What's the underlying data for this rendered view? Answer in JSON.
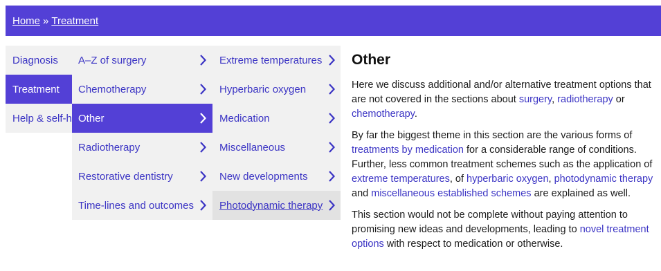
{
  "breadcrumb": {
    "home": "Home",
    "separator": "»",
    "current": "Treatment"
  },
  "nav_level1": [
    {
      "label": "Diagnosis",
      "active": false
    },
    {
      "label": "Treatment",
      "active": true
    },
    {
      "label": "Help & self-help",
      "active": false
    }
  ],
  "nav_level2": [
    {
      "label": "A–Z of surgery"
    },
    {
      "label": "Chemotherapy"
    },
    {
      "label": "Other"
    },
    {
      "label": "Radiotherapy"
    },
    {
      "label": "Restorative dentistry"
    },
    {
      "label": "Time-lines and outcomes"
    }
  ],
  "nav_level3": [
    {
      "label": "Extreme temperatures"
    },
    {
      "label": "Hyperbaric oxygen"
    },
    {
      "label": "Medication"
    },
    {
      "label": "Miscellaneous"
    },
    {
      "label": "New developments"
    },
    {
      "label": "Photodynamic therapy"
    }
  ],
  "icons": {
    "chevron": "chevron-right-icon"
  },
  "colors": {
    "brand": "#5340d6",
    "link": "#3b34c4",
    "menu_bg": "#f1f1f1",
    "hover_bg": "#e2e2e2"
  },
  "content": {
    "title": "Other",
    "p1": {
      "line1": "Here we discuss additional and/or alternative treatment options that",
      "line2_a": "are not covered in the sections about ",
      "link_surgery": "surgery",
      "line2_b": ", ",
      "link_radiotherapy": "radiotherapy",
      "line2_c": " or",
      "link_chemotherapy": "chemotherapy",
      "line3_end": "."
    },
    "p2": {
      "line1": "By far the biggest theme in this section are the various forms of",
      "link_medication": "treatments by medication",
      "line2_b": " for a considerable range of conditions.",
      "line3": "Further, less common treatment schemes such as the application of",
      "link_extreme": "extreme temperatures",
      "line4_b": ", of ",
      "link_hyperbaric": "hyperbaric oxygen",
      "line4_c": ", ",
      "link_photodynamic": "photodynamic therapy",
      "line5_a": "and ",
      "link_misc": "miscellaneous established schemes",
      "line5_b": " are explained as well."
    },
    "p3": {
      "line1": "This section would not be complete without paying attention to",
      "line2_a": "promising new ideas and developments, leading to ",
      "link_novel1": "novel treatment",
      "link_novel2": "options",
      "line3_b": " with respect to medication or otherwise."
    }
  }
}
